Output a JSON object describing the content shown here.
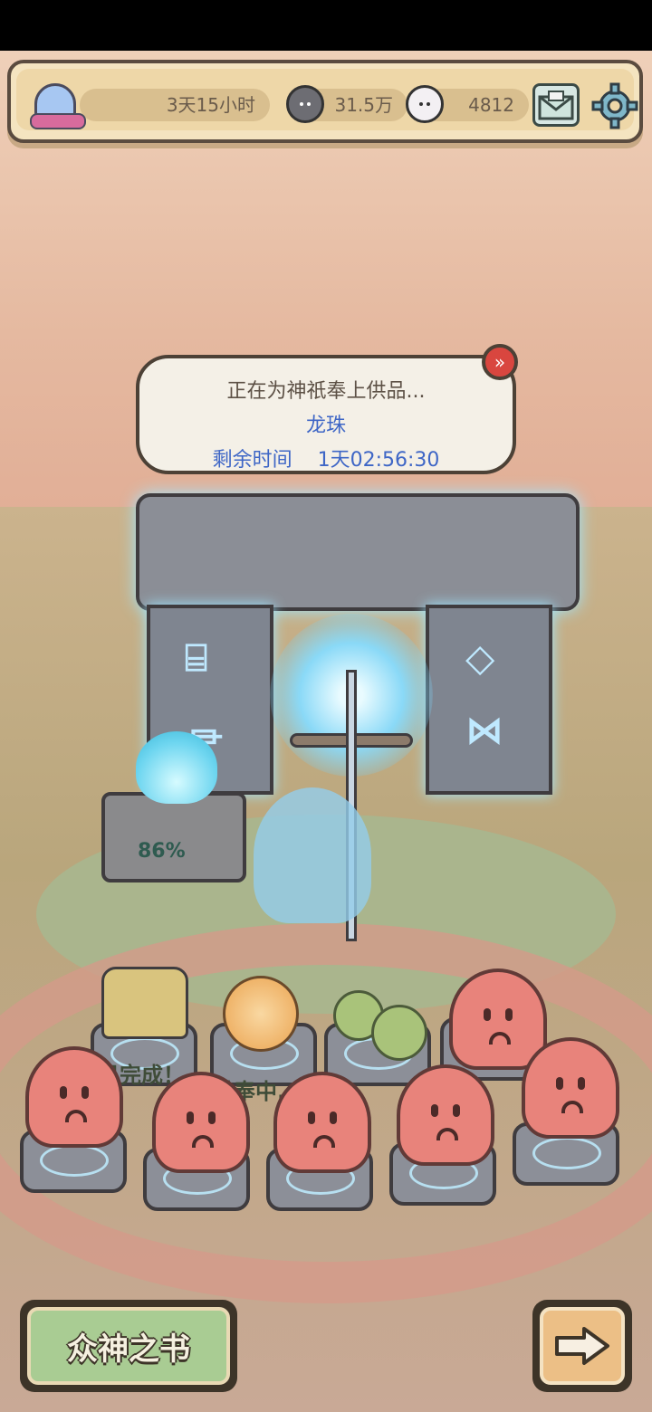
{
  "hud": {
    "countdown": "3天15小时",
    "dark_currency": "31.5万",
    "light_currency": "4812",
    "icons": [
      "ghost-icon",
      "dark-coin-icon",
      "light-coin-icon",
      "mail-icon",
      "gear-icon"
    ]
  },
  "offering": {
    "status": "正在为神祇奉上供品...",
    "item": "龙珠",
    "remaining_label": "剩余时间",
    "remaining_time": "1天02:56:30",
    "fast_forward_icon": "fast-forward-icon"
  },
  "shrine": {
    "progress_percent": "86%"
  },
  "slots": {
    "completed_label": "已完成！",
    "offering_label": "供奉中..."
  },
  "buttons": {
    "book_of_gods": "众神之书",
    "next_icon": "arrow-right-icon"
  },
  "colors": {
    "accent_blue": "#3e66c6",
    "octopus_red": "#e8837b",
    "button_green": "#a9cc93",
    "button_orange": "#ecbf86"
  }
}
